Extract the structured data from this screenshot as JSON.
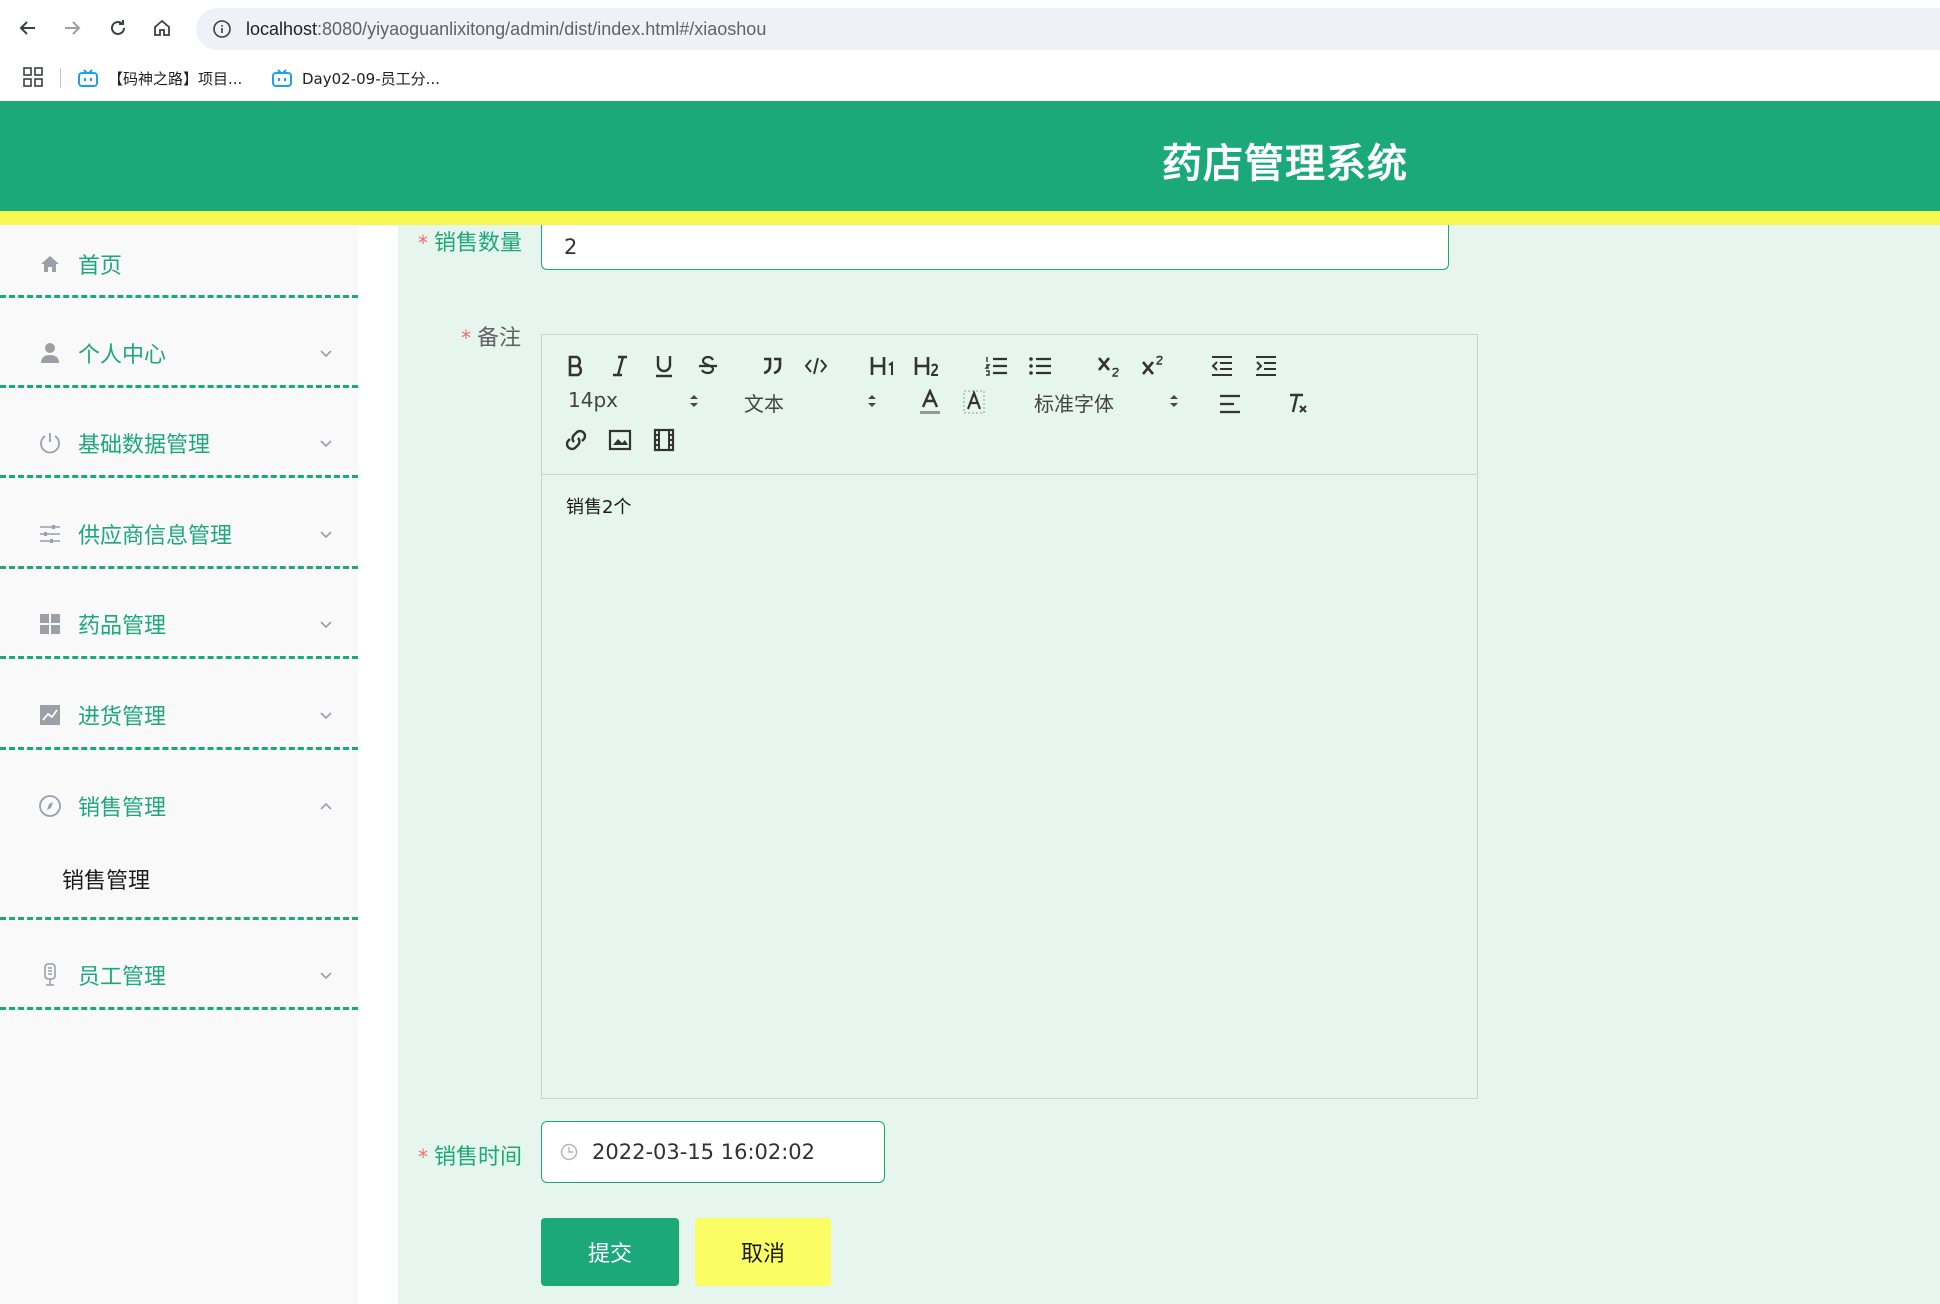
{
  "browser": {
    "url_host": "localhost",
    "url_path": ":8080/yiyaoguanlixitong/admin/dist/index.html#/xiaoshou",
    "bookmarks": [
      {
        "label": "【码神之路】项目..."
      },
      {
        "label": "Day02-09-员工分..."
      }
    ]
  },
  "header": {
    "title": "药店管理系统"
  },
  "sidebar": {
    "items": [
      {
        "label": "首页",
        "icon": "home-icon"
      },
      {
        "label": "个人中心",
        "icon": "user-icon"
      },
      {
        "label": "基础数据管理",
        "icon": "power-icon"
      },
      {
        "label": "供应商信息管理",
        "icon": "sliders-icon"
      },
      {
        "label": "药品管理",
        "icon": "grid-icon"
      },
      {
        "label": "进货管理",
        "icon": "chart-icon"
      },
      {
        "label": "销售管理",
        "icon": "compass-icon"
      },
      {
        "label": "员工管理",
        "icon": "microphone-icon"
      }
    ],
    "submenu": {
      "label": "销售管理"
    }
  },
  "form": {
    "quantity": {
      "label": "销售数量",
      "value": "2"
    },
    "remark": {
      "label": "备注",
      "content": "销售2个",
      "toolbar": {
        "font_size": "14px",
        "header_type": "文本",
        "font_family": "标准字体"
      }
    },
    "sale_time": {
      "label": "销售时间",
      "value": "2022-03-15 16:02:02"
    },
    "submit_label": "提交",
    "cancel_label": "取消"
  },
  "colors": {
    "primary": "#1ba97a",
    "accent_yellow": "#f5f84f",
    "main_bg": "#e6f5ee",
    "required": "#f56c6c"
  }
}
